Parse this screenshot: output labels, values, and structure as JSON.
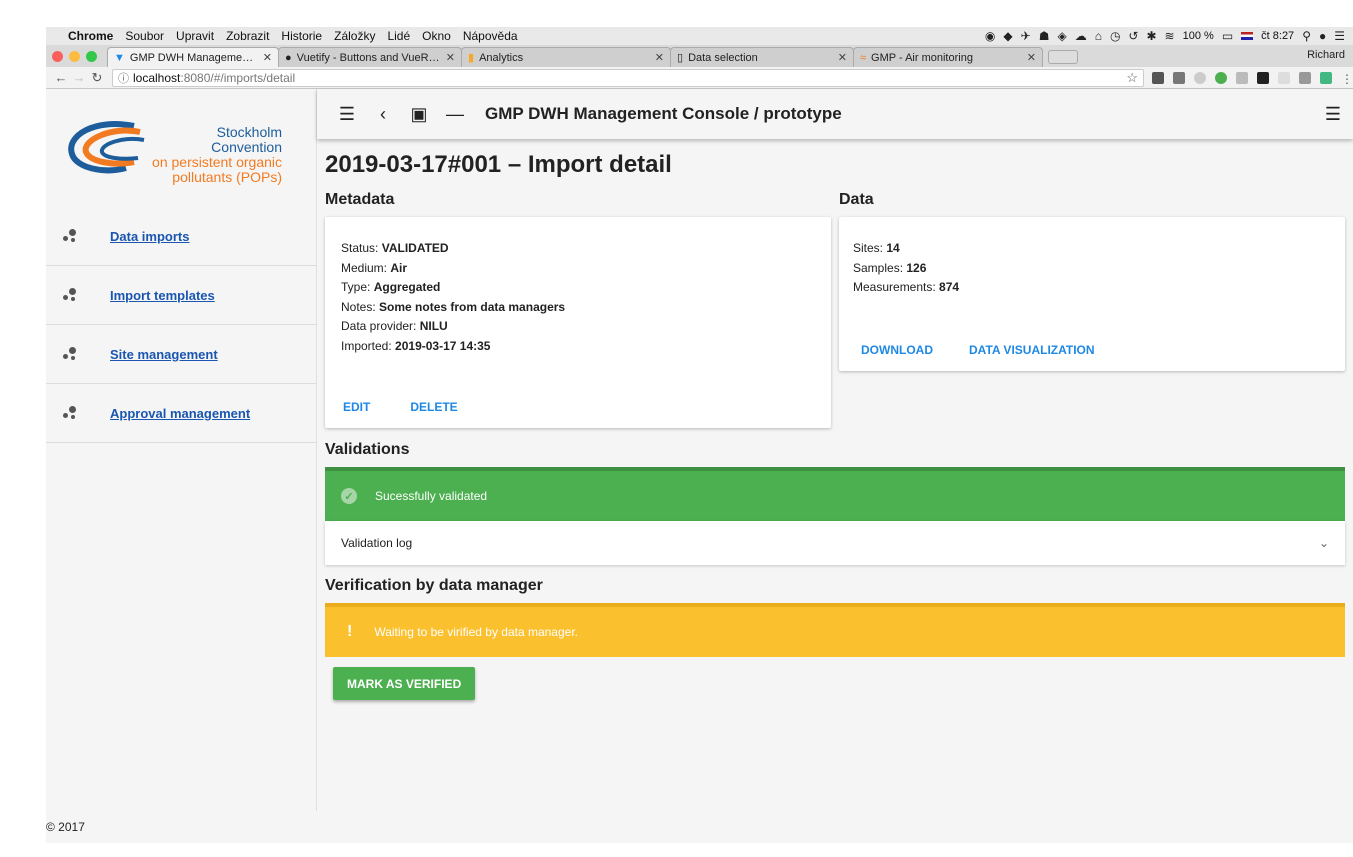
{
  "menubar": {
    "app": "Chrome",
    "items": [
      "Soubor",
      "Upravit",
      "Zobrazit",
      "Historie",
      "Záložky",
      "Lidé",
      "Okno",
      "Nápověda"
    ],
    "battery": "100 %",
    "clock": "čt 8:27"
  },
  "browser": {
    "tabs": [
      {
        "label": "GMP DWH Management Console",
        "icon": "vuetify-icon"
      },
      {
        "label": "Vuetify - Buttons and VueRouter",
        "icon": "github-icon"
      },
      {
        "label": "Analytics",
        "icon": "analytics-icon"
      },
      {
        "label": "Data selection",
        "icon": "page-icon"
      },
      {
        "label": "GMP - Air monitoring",
        "icon": "gmp-icon"
      }
    ],
    "profile": "Richard",
    "url_host": "localhost",
    "url_path": ":8080/#/imports/detail"
  },
  "logo": {
    "line1": "Stockholm Convention",
    "line2": "on persistent organic",
    "line3": "pollutants (POPs)"
  },
  "sidebar": {
    "items": [
      {
        "label": "Data imports"
      },
      {
        "label": "Import templates"
      },
      {
        "label": "Site management"
      },
      {
        "label": "Approval management"
      }
    ]
  },
  "toolbar": {
    "title": "GMP DWH Management Console / prototype"
  },
  "page": {
    "title": "2019-03-17#001 – Import detail"
  },
  "metadata": {
    "heading": "Metadata",
    "status_label": "Status:",
    "status": "VALIDATED",
    "medium_label": "Medium:",
    "medium": "Air",
    "type_label": "Type:",
    "type": "Aggregated",
    "notes_label": "Notes:",
    "notes": "Some notes from data managers",
    "provider_label": "Data provider:",
    "provider": "NILU",
    "imported_label": "Imported:",
    "imported": "2019-03-17 14:35",
    "edit": "EDIT",
    "delete": "DELETE"
  },
  "data": {
    "heading": "Data",
    "sites_label": "Sites:",
    "sites": "14",
    "samples_label": "Samples:",
    "samples": "126",
    "measurements_label": "Measurements:",
    "measurements": "874",
    "download": "DOWNLOAD",
    "visualization": "DATA VISUALIZATION"
  },
  "validations": {
    "heading": "Validations",
    "message": "Sucessfully validated",
    "log": "Validation log",
    "color": "#4caf50"
  },
  "verification": {
    "heading": "Verification by data manager",
    "message": "Waiting to be virified by data manager.",
    "button": "MARK AS VERIFIED",
    "color": "#fbc02d"
  },
  "footer": {
    "copyright": "© 2017"
  }
}
